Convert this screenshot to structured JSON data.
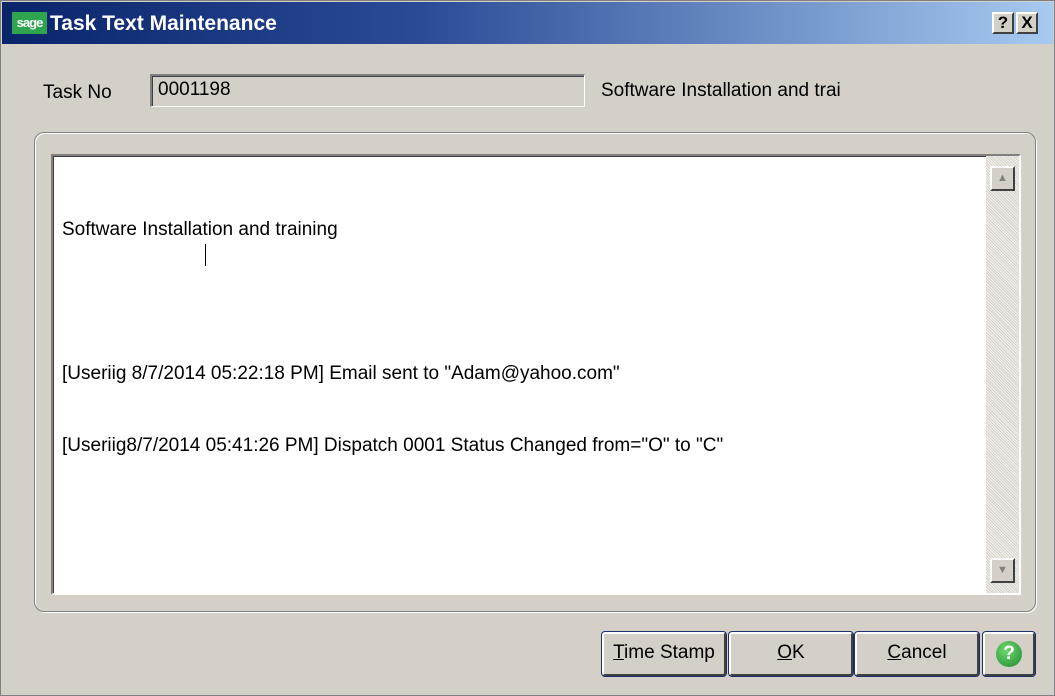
{
  "window": {
    "app_logo": "sage",
    "title": "Task Text Maintenance",
    "help_btn": "?",
    "close_btn": "X"
  },
  "task": {
    "label": "Task No",
    "number": "0001198",
    "description": "Software Installation and trai"
  },
  "memo": {
    "lines": [
      "Software Installation and training",
      "",
      "[Useriig 8/7/2014 05:22:18 PM] Email sent to \"Adam@yahoo.com\"",
      "[Useriig8/7/2014 05:41:26 PM] Dispatch 0001 Status Changed from=\"O\" to \"C\""
    ]
  },
  "scrollbar": {
    "up_icon": "scroll-up-arrow-icon",
    "down_icon": "scroll-down-arrow-icon"
  },
  "buttons": {
    "time_stamp": {
      "first": "T",
      "rest": "ime Stamp"
    },
    "ok": {
      "first": "O",
      "rest": "K"
    },
    "cancel": {
      "first": "C",
      "rest": "ancel"
    },
    "help_icon": "help-icon"
  },
  "colors": {
    "titlebar_start": "#0a246a",
    "titlebar_end": "#a6caf0",
    "window_bg": "#d4d0c8",
    "logo_green": "#2ea44f"
  }
}
